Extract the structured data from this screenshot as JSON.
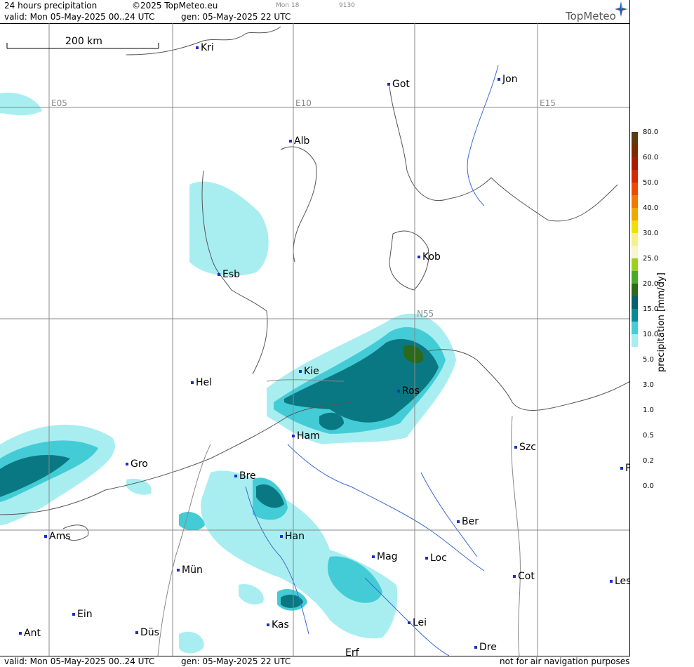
{
  "header": {
    "product": "24 hours precipitation",
    "copyright": "©2025 TopMeteo.eu",
    "run_small": "Mon 18",
    "code_small": "9130",
    "valid": "valid:  Mon  05-May-2025  00..24 UTC",
    "gen": "gen: 05-May-2025 22 UTC",
    "logo": "TopMeteo"
  },
  "footer": {
    "valid": "valid:  Mon  05-May-2025  00..24 UTC",
    "gen": "gen: 05-May-2025 22 UTC",
    "notice": "not for air navigation purposes"
  },
  "scale_bar": "200 km",
  "grid_labels": [
    "E05",
    "E10",
    "E15",
    "N55"
  ],
  "cities": [
    {
      "name": "Kri"
    },
    {
      "name": "Got"
    },
    {
      "name": "Jon"
    },
    {
      "name": "Alb"
    },
    {
      "name": "Kob"
    },
    {
      "name": "Esb"
    },
    {
      "name": "Kie"
    },
    {
      "name": "Hel"
    },
    {
      "name": "Ros"
    },
    {
      "name": "Ham"
    },
    {
      "name": "Szc"
    },
    {
      "name": "Gro"
    },
    {
      "name": "Bre"
    },
    {
      "name": "Ber"
    },
    {
      "name": "Ams"
    },
    {
      "name": "Han"
    },
    {
      "name": "Mag"
    },
    {
      "name": "Loc"
    },
    {
      "name": "Mün"
    },
    {
      "name": "Cot"
    },
    {
      "name": "Les"
    },
    {
      "name": "Ein"
    },
    {
      "name": "Kas"
    },
    {
      "name": "Lei"
    },
    {
      "name": "Ant"
    },
    {
      "name": "Düs"
    },
    {
      "name": "Dre"
    },
    {
      "name": "Erf"
    },
    {
      "name": "P"
    }
  ],
  "legend": {
    "title": "precipitation  [mm/dy]",
    "labels": [
      "80.0",
      "60.0",
      "50.0",
      "40.0",
      "30.0",
      "25.0",
      "20.0",
      "15.0",
      "10.0",
      "5.0",
      "3.0",
      "1.0",
      "0.5",
      "0.2",
      "0.0"
    ],
    "colors": [
      "#5a3a10",
      "#7a2a00",
      "#aa1a00",
      "#d42a00",
      "#f04a00",
      "#f07a00",
      "#f0a800",
      "#f0e000",
      "#f6f28a",
      "#f8f6cc",
      "#9ad222",
      "#4aa82a",
      "#2a6a18",
      "#04606a",
      "#0a8a98",
      "#44ccd6",
      "#a8eef0"
    ]
  },
  "colors": {
    "light_precip": "#a8eef0",
    "medium_precip": "#44ccd6",
    "heavy_precip": "#0a7882",
    "green_precip": "#2a6a18"
  }
}
